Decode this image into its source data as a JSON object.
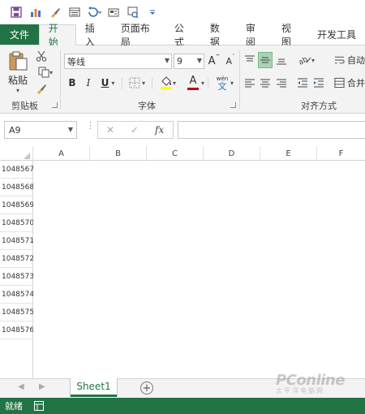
{
  "quick_access": {
    "icons": [
      "save-icon",
      "chart-icon",
      "brush-icon",
      "form-icon",
      "undo-icon",
      "email-icon",
      "preview-icon",
      "customize-icon"
    ]
  },
  "tabs": {
    "file": "文件",
    "home": "开始",
    "insert": "插入",
    "page_layout": "页面布局",
    "formulas": "公式",
    "data": "数据",
    "review": "审阅",
    "view": "视图",
    "developer": "开发工具"
  },
  "ribbon": {
    "clipboard": {
      "paste_label": "粘贴",
      "group_label": "剪贴板"
    },
    "font": {
      "font_name": "等线",
      "font_size": "9",
      "bold": "B",
      "italic": "I",
      "underline": "U",
      "increase_size": "A",
      "decrease_size": "A",
      "font_color": "A",
      "phonetic": "wén",
      "group_label": "字体"
    },
    "alignment": {
      "wrap_text": "自动",
      "merge_center": "合并",
      "group_label": "对齐方式"
    }
  },
  "formula_bar": {
    "name_box": "A9",
    "cancel": "✕",
    "enter": "✓",
    "fx": "fx",
    "formula": ""
  },
  "grid": {
    "columns": [
      "A",
      "B",
      "C",
      "D",
      "E",
      "F"
    ],
    "rows": [
      "1048567",
      "1048568",
      "1048569",
      "1048570",
      "1048571",
      "1048572",
      "1048573",
      "1048574",
      "1048575",
      "1048576"
    ]
  },
  "sheets": {
    "active": "Sheet1",
    "add_symbol": "+"
  },
  "status_bar": {
    "ready": "就绪"
  },
  "watermark": {
    "brand": "PConline",
    "sub": "太平洋电脑网"
  },
  "colors": {
    "accent": "#217346",
    "ribbon_bg": "#f3f3f3",
    "selected_button": "#a9d3b3"
  }
}
